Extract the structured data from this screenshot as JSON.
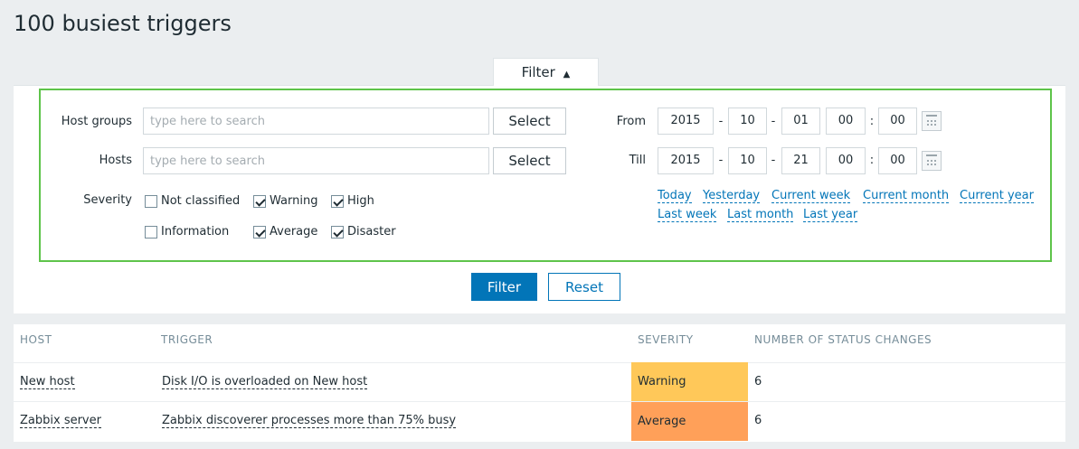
{
  "page": {
    "title": "100 busiest triggers"
  },
  "filter_tab": {
    "label": "Filter",
    "arrow": "▲"
  },
  "filter": {
    "host_groups": {
      "label": "Host groups",
      "placeholder": "type here to search",
      "button": "Select"
    },
    "hosts": {
      "label": "Hosts",
      "placeholder": "type here to search",
      "button": "Select"
    },
    "from": {
      "label": "From",
      "year": "2015",
      "month": "10",
      "day": "01",
      "hour": "00",
      "minute": "00"
    },
    "till": {
      "label": "Till",
      "year": "2015",
      "month": "10",
      "day": "21",
      "hour": "00",
      "minute": "00"
    },
    "severity_label": "Severity",
    "severities": [
      {
        "label": "Not classified",
        "checked": false
      },
      {
        "label": "Warning",
        "checked": true
      },
      {
        "label": "High",
        "checked": true
      },
      {
        "label": "Information",
        "checked": false
      },
      {
        "label": "Average",
        "checked": true
      },
      {
        "label": "Disaster",
        "checked": true
      }
    ],
    "quick_links": [
      "Today",
      "Yesterday",
      "Current week",
      "Current month",
      "Current year",
      "Last week",
      "Last month",
      "Last year"
    ],
    "date_sep": "-",
    "time_sep": ":",
    "apply_label": "Filter",
    "reset_label": "Reset",
    "accent_color": "#5ec44a"
  },
  "table": {
    "headers": [
      "HOST",
      "TRIGGER",
      "SEVERITY",
      "NUMBER OF STATUS CHANGES"
    ],
    "rows": [
      {
        "host": "New host",
        "trigger": "Disk I/O is overloaded on New host",
        "severity": "Warning",
        "severity_color": "#ffc859",
        "changes": "6"
      },
      {
        "host": "Zabbix server",
        "trigger": "Zabbix discoverer processes more than 75% busy",
        "severity": "Average",
        "severity_color": "#ffa059",
        "changes": "6"
      }
    ]
  }
}
